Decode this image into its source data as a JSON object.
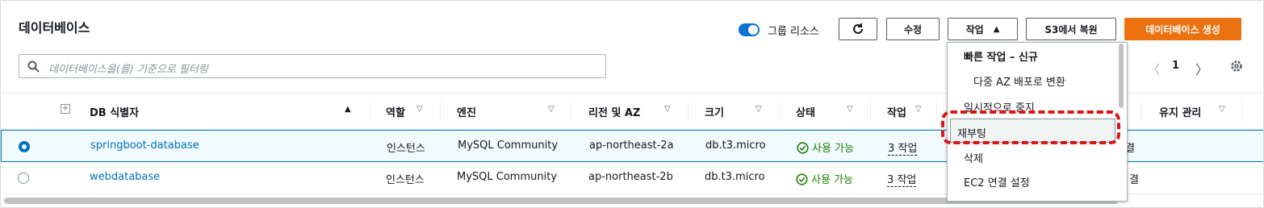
{
  "header": {
    "title": "데이터베이스",
    "group_toggle_label": "그룹 리소스",
    "modify_label": "수정",
    "actions_label": "작업",
    "restore_s3_label": "S3에서 복원",
    "create_db_label": "데이터베이스 생성"
  },
  "search": {
    "placeholder": "데이터베이스을(를) 기준으로 필터링"
  },
  "pager": {
    "current_page": "1"
  },
  "table": {
    "columns": [
      "DB 식별자",
      "역할",
      "엔진",
      "리전 및 AZ",
      "크기",
      "상태",
      "작업",
      "유지 관리"
    ],
    "rows": [
      {
        "id": "springboot-database",
        "role": "인스턴스",
        "engine": "MySQL Community",
        "region": "ap-northeast-2a",
        "size": "db.t3.micro",
        "status": "사용 가능",
        "actions": "3 작업",
        "maintenance": "결",
        "selected": true
      },
      {
        "id": "webdatabase",
        "role": "인스턴스",
        "engine": "MySQL Community",
        "region": "ap-northeast-2b",
        "size": "db.t3.micro",
        "status": "사용 가능",
        "actions": "3 작업",
        "maintenance": "결",
        "selected": false
      }
    ]
  },
  "actions_menu": {
    "group_header": "빠른 작업 – 신규",
    "items": [
      "다중 AZ 배포로 변환",
      "일시적으로 중지",
      "재부팅",
      "삭제",
      "EC2 연결 설정"
    ],
    "highlighted": "재부팅"
  },
  "colors": {
    "accent": "#0073bb",
    "primary_button": "#ec7211",
    "status_ok": "#1d8102",
    "annotation": "#d91515"
  }
}
